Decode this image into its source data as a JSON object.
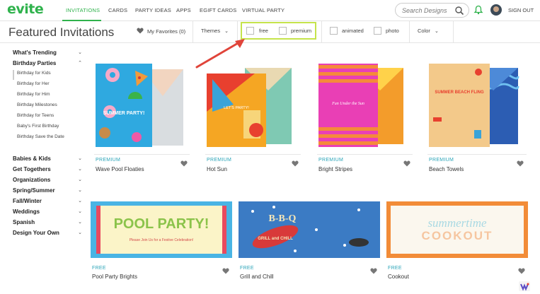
{
  "brand": {
    "logo_text": "evite",
    "accent": "#2fb24c"
  },
  "nav": {
    "items": [
      {
        "label": "INVITATIONS",
        "active": true
      },
      {
        "label": "CARDS"
      },
      {
        "label": "PARTY IDEAS"
      },
      {
        "label": "APPS"
      },
      {
        "label": "EGIFT CARDS"
      },
      {
        "label": "VIRTUAL PARTY"
      }
    ],
    "search_placeholder": "Search Designs",
    "signout_label": "SIGN OUT"
  },
  "filters": {
    "title": "Featured Invitations",
    "favorites_label": "My Favorites (0)",
    "themes_label": "Themes",
    "free_label": "free",
    "premium_label": "premium",
    "animated_label": "animated",
    "photo_label": "photo",
    "color_label": "Color",
    "highlight_color": "#c5e44b"
  },
  "sidebar": {
    "top": [
      {
        "label": "What's Trending"
      },
      {
        "label": "Birthday Parties",
        "expanded": true
      }
    ],
    "sub": [
      {
        "label": "Birthday for Kids"
      },
      {
        "label": "Birthday for Her"
      },
      {
        "label": "Birthday for Him"
      },
      {
        "label": "Birthday Milestones"
      },
      {
        "label": "Birthday for Teens"
      },
      {
        "label": "Baby's First Birthday"
      },
      {
        "label": "Birthday Save the Date"
      }
    ],
    "bottom": [
      {
        "label": "Babies & Kids"
      },
      {
        "label": "Get Togethers"
      },
      {
        "label": "Organizations"
      },
      {
        "label": "Spring/Summer"
      },
      {
        "label": "Fall/Winter"
      },
      {
        "label": "Weddings"
      },
      {
        "label": "Spanish"
      },
      {
        "label": "Design Your Own"
      }
    ]
  },
  "cards_row1": [
    {
      "tag": "PREMIUM",
      "name": "Wave Pool Floaties",
      "art_text": "SUMMER PARTY!",
      "art_bg": "#2fa9e0"
    },
    {
      "tag": "PREMIUM",
      "name": "Hot Sun",
      "art_text": "LET'S PARTY!",
      "art_bg": "#f5a623"
    },
    {
      "tag": "PREMIUM",
      "name": "Bright Stripes",
      "art_text": "Fun Under the Sun",
      "art_bg": "#e93fb5"
    },
    {
      "tag": "PREMIUM",
      "name": "Beach Towels",
      "art_text": "SUMMER BEACH FLING",
      "art_bg": "#f3c98a"
    }
  ],
  "cards_row2": [
    {
      "tag": "FREE",
      "name": "Pool Party Brights",
      "art_text": "POOL PARTY!",
      "art_sub": "Please Join Us for a Festive Celebration!"
    },
    {
      "tag": "FREE",
      "name": "Grill and Chill",
      "art_text": "B-B-Q",
      "art_sub": "GRILL and CHILL"
    },
    {
      "tag": "FREE",
      "name": "Cookout",
      "art_text": "summertime",
      "art_sub": "COOKOUT"
    }
  ]
}
